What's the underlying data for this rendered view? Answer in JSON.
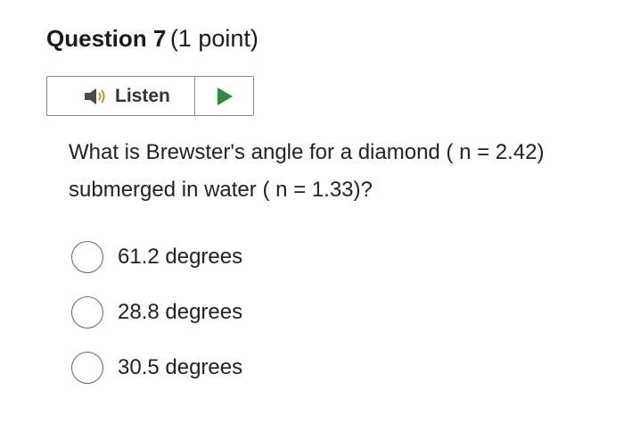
{
  "question": {
    "number_label": "Question 7",
    "points_label": "(1 point)",
    "text": "What is Brewster's angle for a diamond ( n  =  2.42) submerged in water ( n  = 1.33)?"
  },
  "listen": {
    "label": "Listen",
    "speaker_icon": "speaker-icon",
    "play_icon": "play-icon",
    "play_color": "#2e8b3a"
  },
  "options": [
    {
      "label": "61.2 degrees",
      "selected": false
    },
    {
      "label": "28.8 degrees",
      "selected": false
    },
    {
      "label": "30.5 degrees",
      "selected": false
    }
  ]
}
